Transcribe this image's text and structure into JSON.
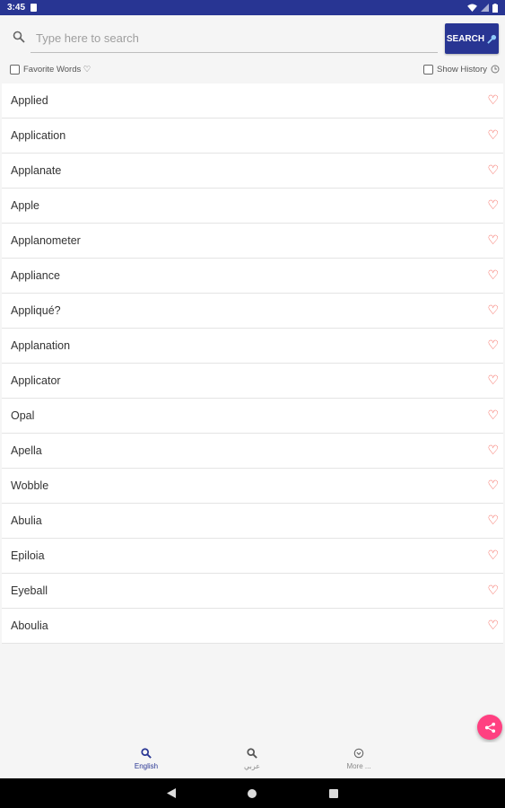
{
  "status_bar": {
    "time": "3:45"
  },
  "search": {
    "placeholder": "Type here to search",
    "button_label": "SEARCH"
  },
  "options": {
    "favorite_label": "Favorite Words ♡",
    "history_label": "Show History"
  },
  "words": [
    {
      "label": "Applied"
    },
    {
      "label": "Application"
    },
    {
      "label": "Applanate"
    },
    {
      "label": "Apple"
    },
    {
      "label": "Applanometer"
    },
    {
      "label": "Appliance"
    },
    {
      "label": "Appliqué?"
    },
    {
      "label": "Applanation"
    },
    {
      "label": "Applicator"
    },
    {
      "label": "Opal"
    },
    {
      "label": "Apella"
    },
    {
      "label": "Wobble"
    },
    {
      "label": "Abulia"
    },
    {
      "label": "Epiloia"
    },
    {
      "label": "Eyeball"
    },
    {
      "label": "Aboulia"
    }
  ],
  "bottom_nav": {
    "tabs": [
      {
        "label": "English",
        "icon": "search-icon",
        "active": true
      },
      {
        "label": "عربي",
        "icon": "search-icon",
        "active": false
      },
      {
        "label": "More ...",
        "icon": "chevron-circle-icon",
        "active": false
      }
    ]
  },
  "colors": {
    "primary": "#283593",
    "accent": "#ff4081",
    "heart": "#f44336"
  }
}
